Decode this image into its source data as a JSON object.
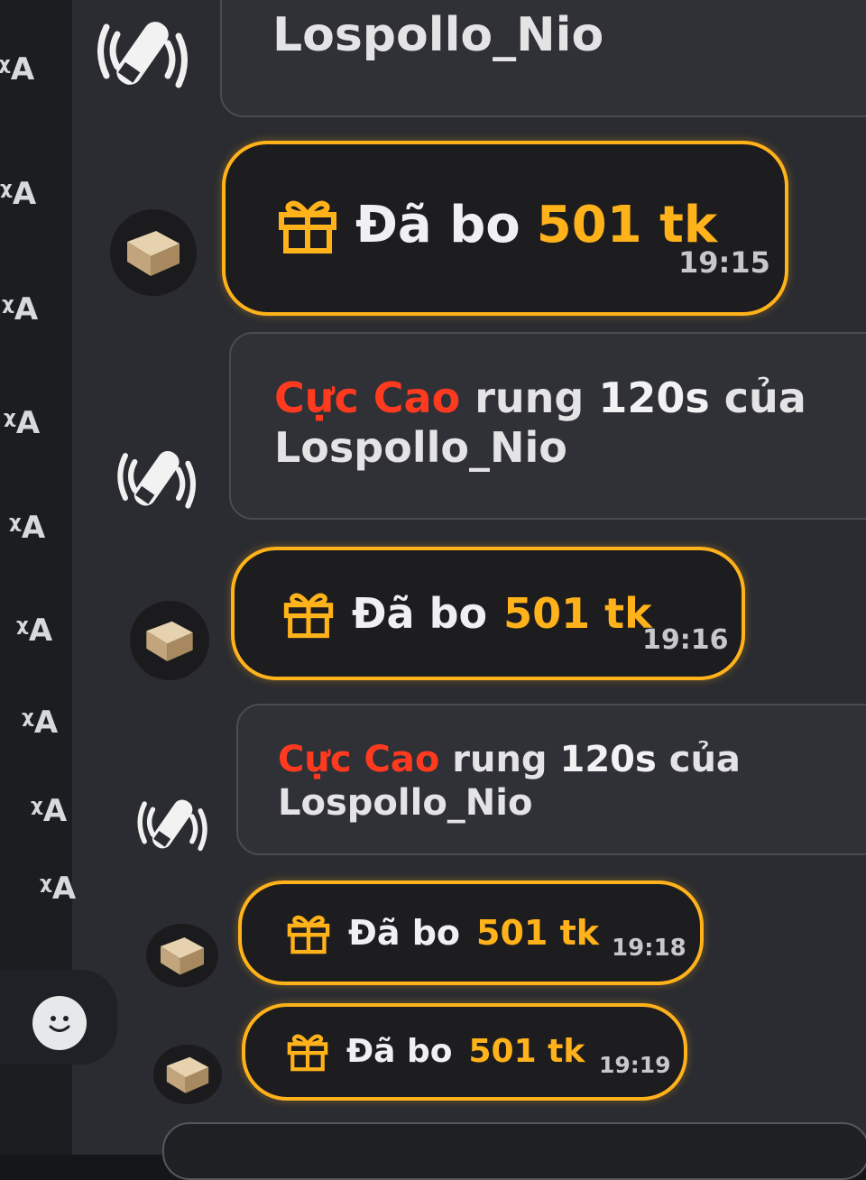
{
  "colors": {
    "accent": "#ffb21a",
    "user_red": "#ff3a1f",
    "panel_bg": "#2a2c31",
    "rail_bg": "#1c1d21"
  },
  "icons": {
    "translate": "translate-icon",
    "vibrator": "vibrator-icon",
    "gift": "gift-icon",
    "emoji": "smiley-face-icon",
    "avatar": "token-box-avatar"
  },
  "messages": [
    {
      "type": "vibration",
      "username": "",
      "suffix": "",
      "name": "Lospollo_Nio"
    },
    {
      "type": "tip",
      "prefix": "Đã bo",
      "amount": "501 tk",
      "time": "19:15"
    },
    {
      "type": "vibration",
      "username": "Cực Cao",
      "mid": "rung",
      "duration": "120s",
      "suffix": "của",
      "name": "Lospollo_Nio"
    },
    {
      "type": "tip",
      "prefix": "Đã bo",
      "amount": "501 tk",
      "time": "19:16"
    },
    {
      "type": "vibration",
      "username": "Cực Cao",
      "mid": "rung",
      "duration": "120s",
      "suffix": "của",
      "name": "Lospollo_Nio"
    },
    {
      "type": "tip",
      "prefix": "Đã bo",
      "amount": "501 tk",
      "time": "19:18"
    },
    {
      "type": "tip",
      "prefix": "Đã bo",
      "amount": "501 tk",
      "time": "19:19"
    }
  ]
}
